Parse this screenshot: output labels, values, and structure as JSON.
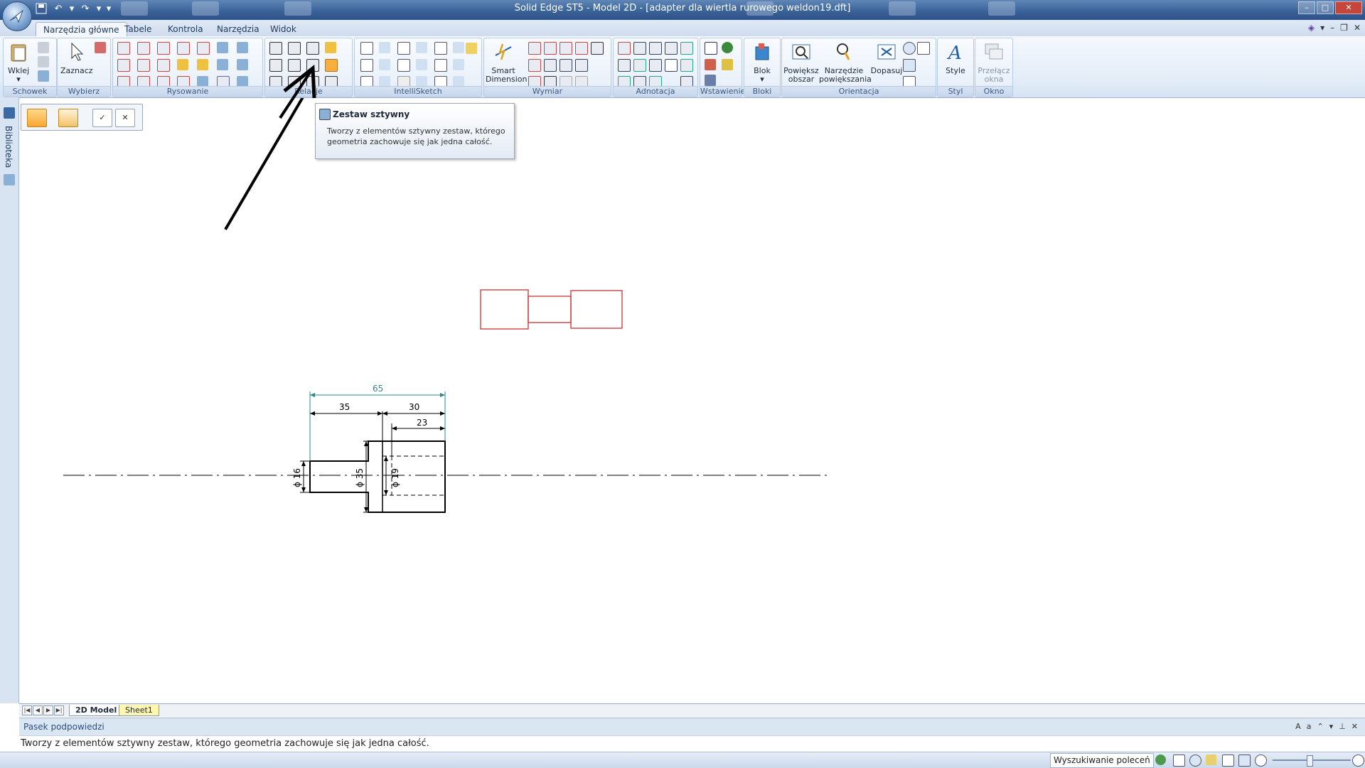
{
  "window": {
    "title": "Solid Edge ST5 - Model 2D - [adapter dla wiertla rurowego weldon19.dft]",
    "controls": {
      "minimize": "–",
      "maximize": "□",
      "close": "✕"
    }
  },
  "mdi_controls": {
    "minimize": "–",
    "restore": "❐",
    "close": "✕"
  },
  "quick_access": {
    "save_icon": "save-icon",
    "undo_icon": "undo-icon",
    "redo_icon": "redo-icon"
  },
  "tabs": [
    {
      "label": "Narzędzia główne",
      "active": true
    },
    {
      "label": "Tabele"
    },
    {
      "label": "Kontrola"
    },
    {
      "label": "Narzędzia"
    },
    {
      "label": "Widok"
    }
  ],
  "ribbon": {
    "groups": {
      "schowek": "Schowek",
      "wybierz": "Wybierz",
      "rysowanie": "Rysowanie",
      "relacje": "Relacje",
      "intellisketch": "IntelliSketch",
      "wymiar": "Wymiar",
      "adnotacja": "Adnotacja",
      "wstawienie": "Wstawienie",
      "bloki": "Bloki",
      "orientacja": "Orientacja",
      "styl": "Styl",
      "okno": "Okno"
    },
    "buttons": {
      "wklej": "Wklej",
      "zaznacz": "Zaznacz",
      "smart_dimension_1": "Smart",
      "smart_dimension_2": "Dimension",
      "blok": "Blok",
      "powieksz_1": "Powiększ",
      "powieksz_2": "obszar",
      "narzedzie_1": "Narzędzie",
      "narzedzie_2": "powiększania",
      "dopasuj": "Dopasuj",
      "style": "Style",
      "przelacz_1": "Przełącz",
      "przelacz_2": "okna"
    }
  },
  "tooltip": {
    "title": "Zestaw sztywny",
    "body": "Tworzy z elementów sztywny zestaw, którego geometria zachowuje się jak jedna całość."
  },
  "left_panel": {
    "library_label": "Biblioteka"
  },
  "drawing": {
    "dimensions": {
      "overall": "65",
      "left_length": "35",
      "right_length": "30",
      "bore_depth": "23",
      "dia_small": "ϕ 16",
      "dia_large": "ϕ 35",
      "dia_bore": "ϕ 19"
    },
    "colors": {
      "profile": "#000000",
      "dimension": "#2a8a8a",
      "sketch": "#c83232"
    }
  },
  "sheets": {
    "active": "2D Model",
    "other": "Sheet1"
  },
  "hint_bar": {
    "title": "Pasek podpowiedzi",
    "text": "Tworzy z elementów sztywny zestaw, którego geometria zachowuje się jak jedna całość."
  },
  "status": {
    "command_search": "Wyszukiwanie poleceń"
  }
}
